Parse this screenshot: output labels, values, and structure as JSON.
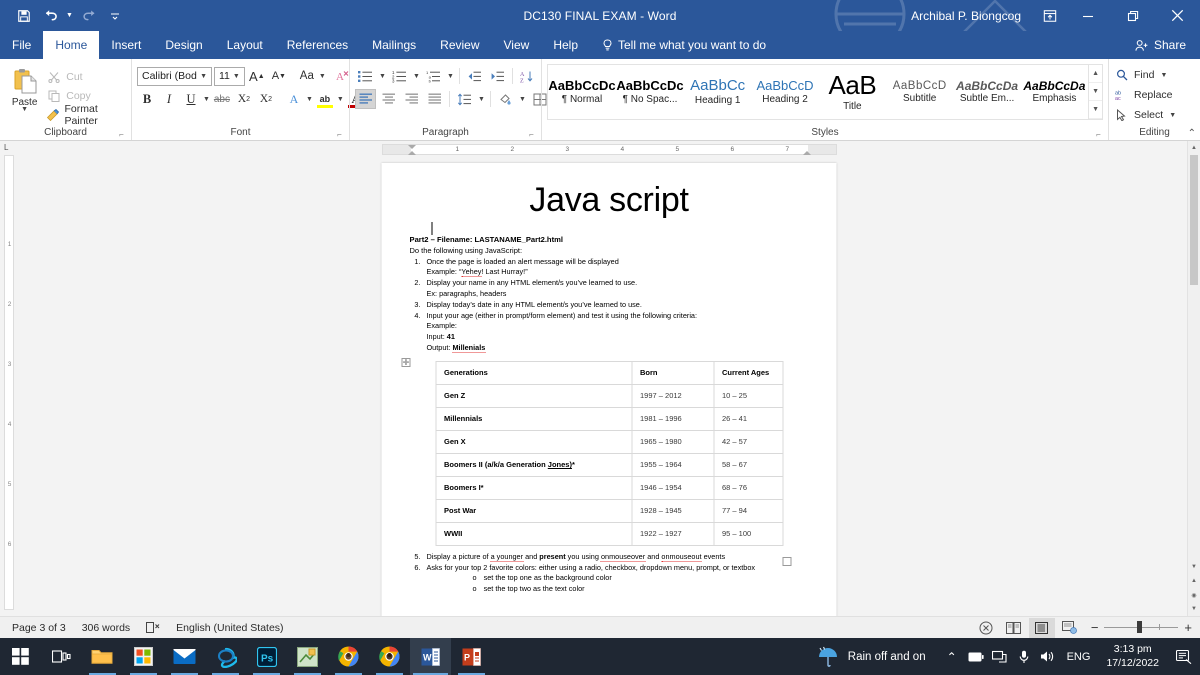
{
  "titlebar": {
    "document_title": "DC130 FINAL EXAM  -  Word",
    "user_name": "Archibal P. Biongcog",
    "qat": [
      {
        "name": "save-icon",
        "label": "Save"
      },
      {
        "name": "undo-icon",
        "label": "Undo"
      },
      {
        "name": "redo-icon",
        "label": "Redo"
      },
      {
        "name": "customize-qat-icon",
        "label": "Customize Quick Access Toolbar"
      }
    ],
    "ribbon_display_label": "Ribbon Display Options",
    "minimize_label": "Minimize",
    "restore_label": "Restore Down",
    "close_label": "Close"
  },
  "tabs": [
    {
      "label": "File",
      "active": false
    },
    {
      "label": "Home",
      "active": true
    },
    {
      "label": "Insert",
      "active": false
    },
    {
      "label": "Design",
      "active": false
    },
    {
      "label": "Layout",
      "active": false
    },
    {
      "label": "References",
      "active": false
    },
    {
      "label": "Mailings",
      "active": false
    },
    {
      "label": "Review",
      "active": false
    },
    {
      "label": "View",
      "active": false
    },
    {
      "label": "Help",
      "active": false
    }
  ],
  "tellme": {
    "label": "Tell me what you want to do"
  },
  "share": {
    "label": "Share"
  },
  "ribbon": {
    "clipboard": {
      "group_label": "Clipboard",
      "paste_label": "Paste",
      "items": [
        {
          "label": "Cut",
          "enabled": false
        },
        {
          "label": "Copy",
          "enabled": false
        },
        {
          "label": "Format Painter",
          "enabled": true
        }
      ]
    },
    "font": {
      "group_label": "Font",
      "font_name": "Calibri (Body)",
      "font_size": "11",
      "buttons": [
        {
          "name": "grow-font-icon",
          "label": "A"
        },
        {
          "name": "shrink-font-icon",
          "label": "A"
        },
        {
          "name": "change-case-icon",
          "label": "Aa"
        },
        {
          "name": "clear-formatting-icon",
          "label": "A"
        },
        {
          "name": "bold-icon",
          "label": "B"
        },
        {
          "name": "italic-icon",
          "label": "I"
        },
        {
          "name": "underline-icon",
          "label": "U"
        },
        {
          "name": "strikethrough-icon",
          "label": "abc"
        },
        {
          "name": "subscript-icon",
          "label": "X"
        },
        {
          "name": "superscript-icon",
          "label": "X"
        },
        {
          "name": "text-effects-icon",
          "label": "A"
        },
        {
          "name": "text-highlight-icon",
          "label": "ab"
        },
        {
          "name": "font-color-icon",
          "label": "A"
        }
      ],
      "highlight_color": "#ffff00",
      "font_color": "#c00000"
    },
    "paragraph": {
      "group_label": "Paragraph"
    },
    "styles": {
      "group_label": "Styles",
      "gallery": [
        {
          "preview": "AaBbCcDc",
          "name": "¶ Normal",
          "style": "normal"
        },
        {
          "preview": "AaBbCcDc",
          "name": "¶ No Spac...",
          "style": "normal"
        },
        {
          "preview": "AaBbCс",
          "name": "Heading 1",
          "style": "blue"
        },
        {
          "preview": "AaBbCcD",
          "name": "Heading 2",
          "style": "blue"
        },
        {
          "preview": "AaB",
          "name": "Title",
          "style": "big"
        },
        {
          "preview": "AaBbCcD",
          "name": "Subtitle",
          "style": "sub"
        },
        {
          "preview": "AaBbCcDa",
          "name": "Subtle Em...",
          "style": "em"
        },
        {
          "preview": "AaBbCcDa",
          "name": "Emphasis",
          "style": "em2"
        }
      ]
    },
    "editing": {
      "group_label": "Editing",
      "items": [
        {
          "label": "Find",
          "icon": "search-icon",
          "caret": true
        },
        {
          "label": "Replace",
          "icon": "replace-icon",
          "caret": false
        },
        {
          "label": "Select",
          "icon": "select-icon",
          "caret": true
        }
      ]
    }
  },
  "ruler": {
    "corner_label": "L",
    "horizontal_ticks": [
      "1",
      "2",
      "3",
      "4",
      "5",
      "6",
      "7"
    ]
  },
  "document": {
    "title": "Java script",
    "part_header": "Part2 – Filename: LASTANAME_Part2.html",
    "intro": "Do the following using JavaScript:",
    "items": [
      {
        "num": "1.",
        "text": "Once the page is loaded an alert message will be displayed",
        "sub": [
          "Example:  “Yehey! Last Hurray!”"
        ]
      },
      {
        "num": "2.",
        "text": "Display your name in any HTML element/s you’ve learned to use.",
        "sub": [
          "Ex: paragraphs, headers"
        ]
      },
      {
        "num": "3.",
        "text": "Display today’s date in any HTML element/s you’ve learned to use.",
        "sub": []
      },
      {
        "num": "4.",
        "text": "Input your age (either in prompt/form element) and test it using the following criteria:",
        "sub": [
          "Example:",
          "Input: 41",
          "Output: Millenials"
        ]
      }
    ],
    "table": {
      "headers": [
        "Generations",
        "Born",
        "Current Ages"
      ],
      "rows": [
        {
          "generation": "Gen Z",
          "born": "1997 – 2012",
          "ages": "10 – 25"
        },
        {
          "generation": "Millennials",
          "born": "1981 – 1996",
          "ages": "26 – 41"
        },
        {
          "generation": "Gen X",
          "born": "1965 – 1980",
          "ages": "42 – 57"
        },
        {
          "generation": "Boomers II (a/k/a Generation Jones)*",
          "born": "1955 – 1964",
          "ages": "58 – 67"
        },
        {
          "generation": "Boomers I*",
          "born": "1946 – 1954",
          "ages": "68 – 76"
        },
        {
          "generation": "Post War",
          "born": "1928 – 1945",
          "ages": "77 – 94"
        },
        {
          "generation": "WWII",
          "born": "1922 – 1927",
          "ages": "95 – 100"
        }
      ]
    },
    "items_after": [
      {
        "num": "5.",
        "text": "Display a picture of a  younger and present you using onmouseover and onmouseout events",
        "bullets": []
      },
      {
        "num": "6.",
        "text": "Asks for your top 2 favorite colors: either using a radio, checkbox, dropdown menu, prompt, or textbox",
        "bullets": [
          "set the top one as the background color",
          "set the top two as the text color"
        ]
      }
    ],
    "bullet_glyph": "o"
  },
  "statusbar": {
    "page": "Page 3 of 3",
    "words": "306 words",
    "proofing_icon": "spelling-check-icon",
    "language": "English (United States)",
    "views": [
      {
        "name": "read-mode-icon",
        "selected": false
      },
      {
        "name": "print-layout-icon",
        "selected": true
      },
      {
        "name": "web-layout-icon",
        "selected": false
      }
    ],
    "accessibility_icon": "accessibility-icon",
    "zoom_out": "−",
    "zoom_in": "+"
  },
  "taskbar": {
    "items": [
      {
        "name": "start-button",
        "label": "Start"
      },
      {
        "name": "task-view-button",
        "label": "Task View"
      },
      {
        "name": "file-explorer-icon",
        "label": "File Explorer"
      },
      {
        "name": "microsoft-store-icon",
        "label": "Microsoft Store"
      },
      {
        "name": "mail-icon",
        "label": "Mail"
      },
      {
        "name": "internet-explorer-icon",
        "label": "Internet Explorer"
      },
      {
        "name": "photoshop-icon",
        "label": "Ps"
      },
      {
        "name": "paint-icon",
        "label": "Paint"
      },
      {
        "name": "chrome-icon-1",
        "label": "Google Chrome"
      },
      {
        "name": "chrome-icon-2",
        "label": "Google Chrome"
      },
      {
        "name": "word-icon",
        "label": "Word"
      },
      {
        "name": "powerpoint-icon",
        "label": "PowerPoint"
      }
    ],
    "weather": "Rain off and on",
    "language": "ENG",
    "time": "3:13 pm",
    "date": "17/12/2022",
    "notifications_icon": "notifications-icon"
  },
  "colors": {
    "word_blue": "#2b579a",
    "accent_blue": "#2e74b5",
    "taskbar": "#1f2733"
  }
}
